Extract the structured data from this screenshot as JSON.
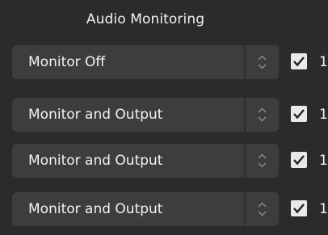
{
  "header": {
    "title": "Audio Monitoring"
  },
  "rows": [
    {
      "value": "Monitor Off",
      "checked": true,
      "check_label": "1"
    },
    {
      "value": "Monitor and Output",
      "checked": true,
      "check_label": "1"
    },
    {
      "value": "Monitor and Output",
      "checked": true,
      "check_label": "1"
    },
    {
      "value": "Monitor and Output",
      "checked": true,
      "check_label": "1"
    }
  ],
  "icons": {
    "spinner": "up-down-chevron-icon",
    "check": "checkmark-icon"
  },
  "colors": {
    "background": "#2b2b2b",
    "control": "#3d3d3d",
    "text": "#f2f2f2",
    "checkbox": "#e9e9e9"
  }
}
